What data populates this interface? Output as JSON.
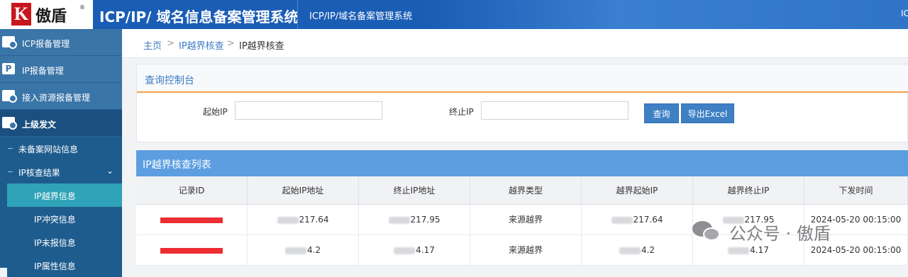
{
  "header": {
    "logo_letter": "K",
    "logo_text": "傲盾",
    "logo_mark": "®",
    "title": "ICP/IP/ 域名信息备案管理系统",
    "subtitle": "ICP/IP/域名备案管理系统",
    "user_short": "IC"
  },
  "sidebar": {
    "main_items": [
      {
        "label": "ICP报备管理",
        "icon": "folder-gear-icon"
      },
      {
        "label": "IP报备管理",
        "icon": "ip-icon"
      },
      {
        "label": "接入资源报备管理",
        "icon": "folder-gear-icon"
      },
      {
        "label": "上级发文",
        "icon": "folder-gear-icon"
      }
    ],
    "sub_items": [
      {
        "label": "未备案网站信息"
      },
      {
        "label": "IP核查结果",
        "expanded": true
      }
    ],
    "leaf_items": [
      {
        "label": "IP越界信息",
        "active": true
      },
      {
        "label": "IP冲突信息"
      },
      {
        "label": "IP未报信息"
      },
      {
        "label": "IP属性信息"
      }
    ]
  },
  "breadcrumb": {
    "home": "主页",
    "level1": "IP越界核查",
    "current": "IP越界核查",
    "sep": ">"
  },
  "query_panel": {
    "title": "查询控制台",
    "start_ip_label": "起始IP",
    "start_ip_value": "",
    "end_ip_label": "终止IP",
    "end_ip_value": "",
    "search_button": "查询",
    "export_button": "导出Excel"
  },
  "list": {
    "title": "IP越界核查列表",
    "columns": [
      "记录ID",
      "起始IP地址",
      "终止IP地址",
      "越界类型",
      "越界起始IP",
      "越界终止IP",
      "下发时间"
    ],
    "rows": [
      {
        "record_id": "",
        "start_ip": "217.64",
        "end_ip": "217.95",
        "type": "来源越界",
        "over_start": "217.64",
        "over_end": "217.95",
        "time": "2024-05-20 00:15:00"
      },
      {
        "record_id": "",
        "start_ip": "4.2",
        "end_ip": "4.17",
        "type": "来源越界",
        "over_start": "4.2",
        "over_end": "4.17",
        "time": "2024-05-20 00:15:00"
      }
    ]
  },
  "watermark": {
    "text": "公众号 · 傲盾"
  },
  "colors": {
    "header_bg": "#1a5db5",
    "sidebar_bg": "#1e5c8e",
    "active_leaf": "#2fa3b7",
    "list_header": "#5c9ee0",
    "panel_accent": "#f0a24a",
    "button": "#3f80c4",
    "redaction": "#ec2d32"
  }
}
